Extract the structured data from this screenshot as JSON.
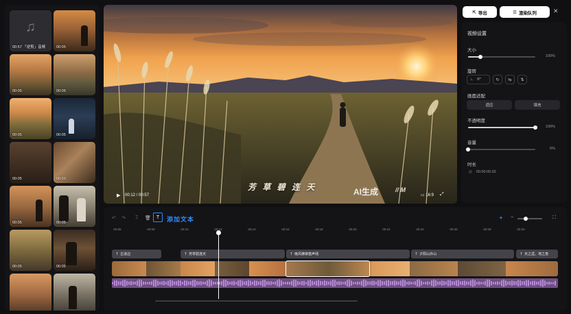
{
  "library": {
    "items": [
      {
        "type": "audio",
        "duration": "00:57",
        "label": "「逆剪」音频"
      },
      {
        "type": "video",
        "duration": "00:05"
      },
      {
        "type": "video",
        "duration": "00:05"
      },
      {
        "type": "video",
        "duration": "00:05"
      },
      {
        "type": "video",
        "duration": "00:05"
      },
      {
        "type": "video",
        "duration": "00:05"
      },
      {
        "type": "video",
        "duration": "00:05"
      },
      {
        "type": "video",
        "duration": "00:03"
      },
      {
        "type": "video",
        "duration": "00:05"
      },
      {
        "type": "video",
        "duration": "00:05"
      },
      {
        "type": "video",
        "duration": "00:05"
      },
      {
        "type": "video",
        "duration": "00:05"
      },
      {
        "type": "video",
        "duration": ""
      },
      {
        "type": "video",
        "duration": ""
      }
    ]
  },
  "preview": {
    "subtitle": "芳 草 碧 连 天",
    "watermark": "AI生成",
    "brand": "M",
    "time": "00:12 / 00:57",
    "ratio": "16:9"
  },
  "topbar": {
    "export_label": "导出",
    "render_queue_label": "渲染队列"
  },
  "settings": {
    "title": "视频设置",
    "size_label": "大小",
    "size_value": "100%",
    "size_level": 0.18,
    "rotate_label": "旋转",
    "rotate_value": "0°",
    "fit_label": "画面适配",
    "fit_options": [
      "适应",
      "填充"
    ],
    "opacity_label": "不透明度",
    "opacity_value": "100%",
    "opacity_level": 1.0,
    "volume_label": "音量",
    "volume_value": "0%",
    "volume_level": 0.0,
    "duration_label": "时长",
    "duration_value": "00:00:00.02"
  },
  "timeline": {
    "add_text_label": "添加文本",
    "ruler": [
      "00:06",
      "00:08",
      "00:10",
      "00:12",
      "00:14",
      "00:16",
      "00:18",
      "00:20",
      "00:22",
      "00:24",
      "00:26",
      "00:28",
      "00:30"
    ],
    "text_clips": [
      "古道边",
      "芳草碧连天",
      "晚风拂柳笛声残",
      "夕阳山外山",
      "天之涯，地之角"
    ]
  },
  "colors": {
    "accent": "#2e8bff",
    "audio_wave": "#b78ad6",
    "panel": "#141417"
  }
}
